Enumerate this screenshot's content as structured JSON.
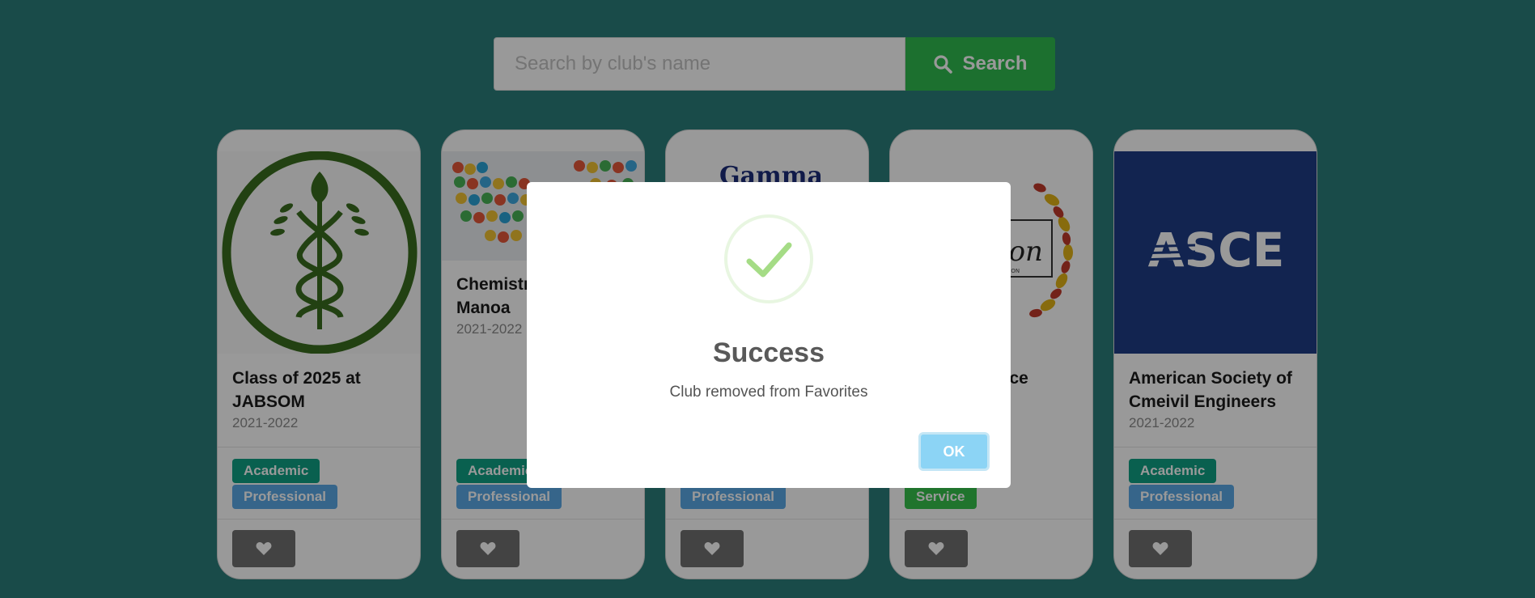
{
  "search": {
    "placeholder": "Search by club's name",
    "button_label": "Search"
  },
  "cards": [
    {
      "title": "Class of 2025 at JABSOM",
      "year": "2021-2022",
      "tags": [
        "Academic",
        "Professional"
      ]
    },
    {
      "title": "Chemistry Club at UH Manoa",
      "title_visible": "Chemistr… UH Man…",
      "year": "2021-2022",
      "tags": [
        "Academic",
        "Professional"
      ]
    },
    {
      "title": "",
      "image_text": "Gamma",
      "year": "",
      "tags": [
        "Professional"
      ]
    },
    {
      "title": "ance",
      "image_text": "thon",
      "image_subtext": "THON",
      "year": "",
      "tags": [
        "Service"
      ]
    },
    {
      "title": "American Society of Cmeivil Engineers",
      "image_text": "ASCE",
      "year": "2021-2022",
      "tags": [
        "Academic",
        "Professional"
      ]
    }
  ],
  "modal": {
    "title": "Success",
    "message": "Club removed from Favorites",
    "ok_label": "OK"
  },
  "colors": {
    "background": "#2a7d7a",
    "search_button": "#2fbb4f",
    "tag_academic": "#10a084",
    "tag_professional": "#5ba8e6",
    "tag_service": "#36c24c",
    "ok_button": "#8cd4f5",
    "success_check": "#a5dc86",
    "asce_blue": "#1f3d86"
  },
  "icons": {
    "search": "search-icon",
    "favorite": "heart-icon",
    "success": "checkmark-icon"
  }
}
